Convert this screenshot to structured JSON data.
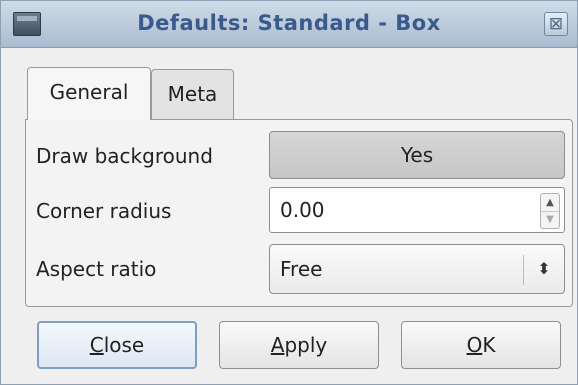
{
  "window": {
    "title": "Defaults: Standard - Box",
    "close_glyph": "⊠",
    "icon": "window-icon"
  },
  "tabs": [
    {
      "label": "General",
      "selected": true
    },
    {
      "label": "Meta",
      "selected": false
    }
  ],
  "fields": {
    "draw_background": {
      "label": "Draw background",
      "value": "Yes"
    },
    "corner_radius": {
      "label": "Corner radius",
      "value": "0.00"
    },
    "aspect_ratio": {
      "label": "Aspect ratio",
      "value": "Free"
    }
  },
  "buttons": {
    "close": {
      "mnemonic": "C",
      "rest": "lose"
    },
    "apply": {
      "mnemonic": "A",
      "rest": "pply"
    },
    "ok": {
      "mnemonic": "O",
      "rest": "K"
    }
  },
  "colors": {
    "title_text": "#3a5a8c",
    "titlebar": "#b9c9da",
    "default_button_border": "#7e9ec4"
  }
}
